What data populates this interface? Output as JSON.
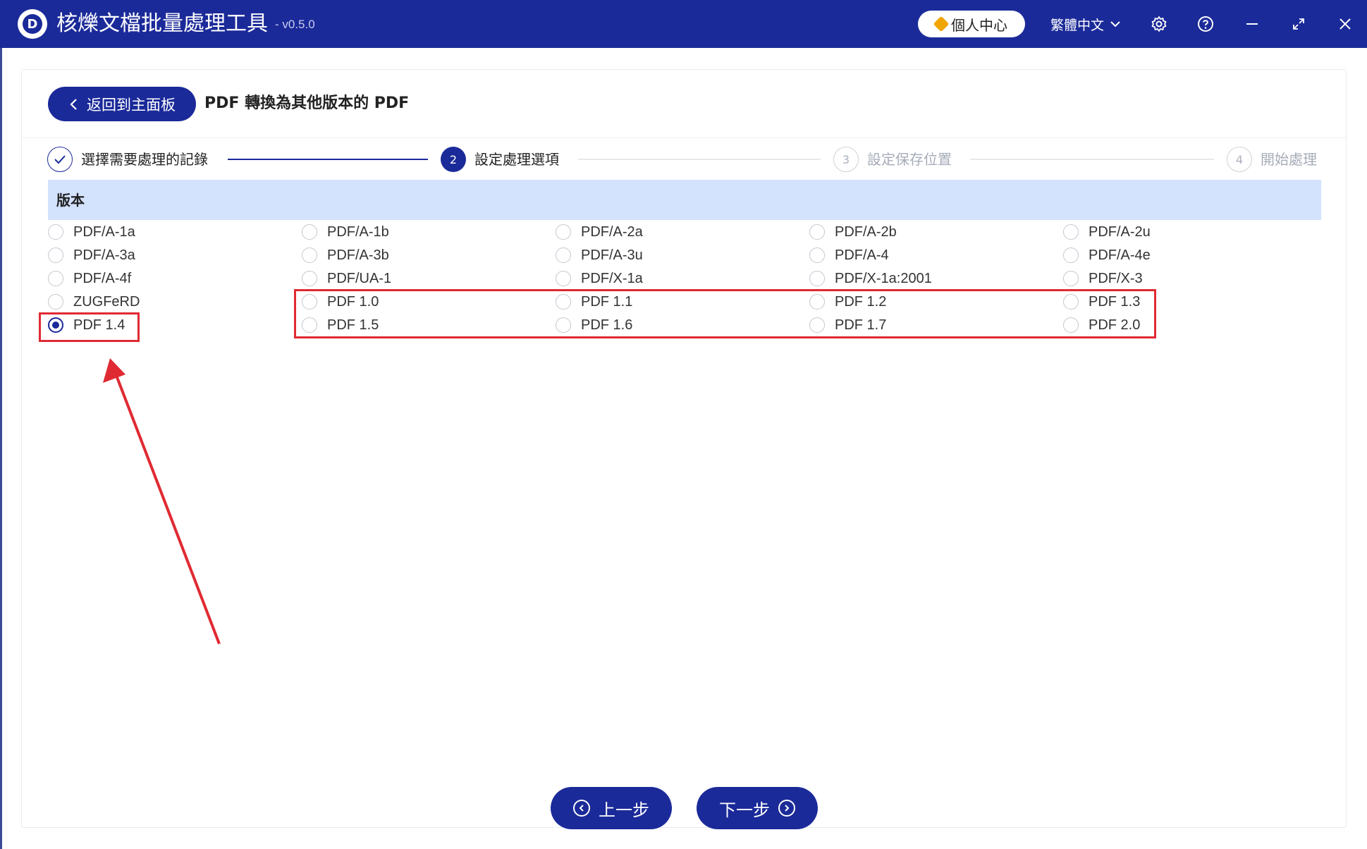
{
  "app": {
    "title": "核爍文檔批量處理工具",
    "version": "- v0.5.0",
    "logo_letter": "D"
  },
  "titlebar": {
    "personal_center": "個人中心",
    "language": "繁體中文"
  },
  "header": {
    "back_label": "返回到主面板",
    "page_title": "PDF 轉換為其他版本的 PDF"
  },
  "steps": [
    {
      "num": "✓",
      "label": "選擇需要處理的記錄",
      "state": "done"
    },
    {
      "num": "2",
      "label": "設定處理選項",
      "state": "active"
    },
    {
      "num": "3",
      "label": "設定保存位置",
      "state": "pending"
    },
    {
      "num": "4",
      "label": "開始處理",
      "state": "pending"
    }
  ],
  "section": {
    "title": "版本"
  },
  "options": [
    [
      "PDF/A-1a",
      "PDF/A-1b",
      "PDF/A-2a",
      "PDF/A-2b",
      "PDF/A-2u"
    ],
    [
      "PDF/A-3a",
      "PDF/A-3b",
      "PDF/A-3u",
      "PDF/A-4",
      "PDF/A-4e"
    ],
    [
      "PDF/A-4f",
      "PDF/UA-1",
      "PDF/X-1a",
      "PDF/X-1a:2001",
      "PDF/X-3"
    ],
    [
      "ZUGFeRD",
      "PDF 1.0",
      "PDF 1.1",
      "PDF 1.2",
      "PDF 1.3"
    ],
    [
      "PDF 1.4",
      "PDF 1.5",
      "PDF 1.6",
      "PDF 1.7",
      "PDF 2.0"
    ]
  ],
  "selected_option": "PDF 1.4",
  "footer": {
    "prev_label": "上一步",
    "next_label": "下一步"
  },
  "colors": {
    "primary": "#1b2a99",
    "section_bg": "#d3e2fd",
    "highlight": "#e02a32"
  }
}
